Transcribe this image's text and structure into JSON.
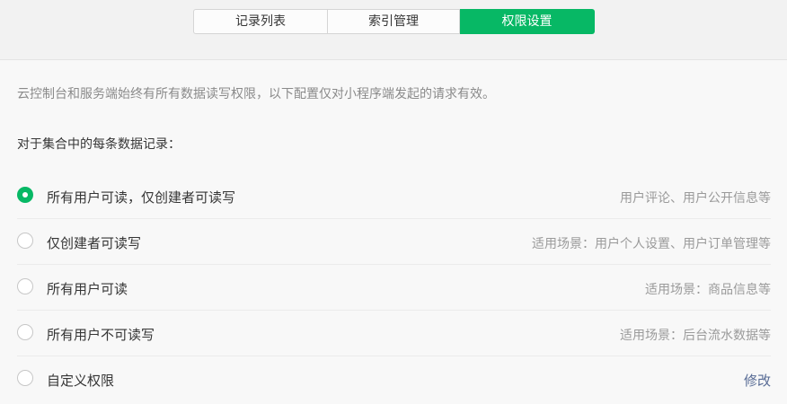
{
  "tabs": [
    {
      "label": "记录列表",
      "active": false
    },
    {
      "label": "索引管理",
      "active": false
    },
    {
      "label": "权限设置",
      "active": true
    }
  ],
  "description": "云控制台和服务端始终有所有数据读写权限，以下配置仅对小程序端发起的请求有效。",
  "section_title": "对于集合中的每条数据记录：",
  "options": [
    {
      "label": "所有用户可读，仅创建者可读写",
      "hint": "用户评论、用户公开信息等",
      "checked": true
    },
    {
      "label": "仅创建者可读写",
      "hint": "适用场景：用户个人设置、用户订单管理等",
      "checked": false
    },
    {
      "label": "所有用户可读",
      "hint": "适用场景：商品信息等",
      "checked": false
    },
    {
      "label": "所有用户不可读写",
      "hint": "适用场景：后台流水数据等",
      "checked": false
    },
    {
      "label": "自定义权限",
      "action": "修改",
      "checked": false
    }
  ],
  "colors": {
    "accent": "#07b865",
    "link": "#576b95"
  }
}
